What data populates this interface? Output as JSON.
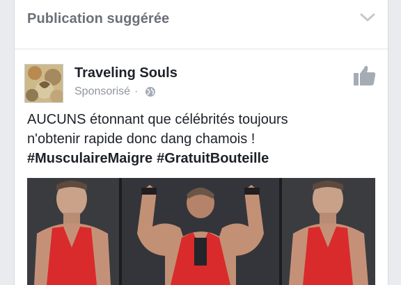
{
  "header": {
    "title": "Publication suggérée",
    "menu_icon": "chevron-down-icon"
  },
  "post": {
    "page_name": "Traveling Souls",
    "sponsored_label": "Sponsorisé",
    "privacy_icon": "globe-icon",
    "like_icon": "thumbs-up-icon",
    "text_lines": [
      "AUCUNS étonnant que célébrités toujours",
      "n'obtenir rapide donc dang chamois !"
    ],
    "hashtags": [
      "#MusculaireMaigre",
      "#GratuitBouteille"
    ]
  },
  "colors": {
    "background": "#e9ebee",
    "card": "#ffffff",
    "header_text": "#6b6f78",
    "secondary_text": "#90949c",
    "primary_text": "#1d2129",
    "like_icon": "#a6acb6",
    "tank_top_red": "#d92b2b"
  }
}
